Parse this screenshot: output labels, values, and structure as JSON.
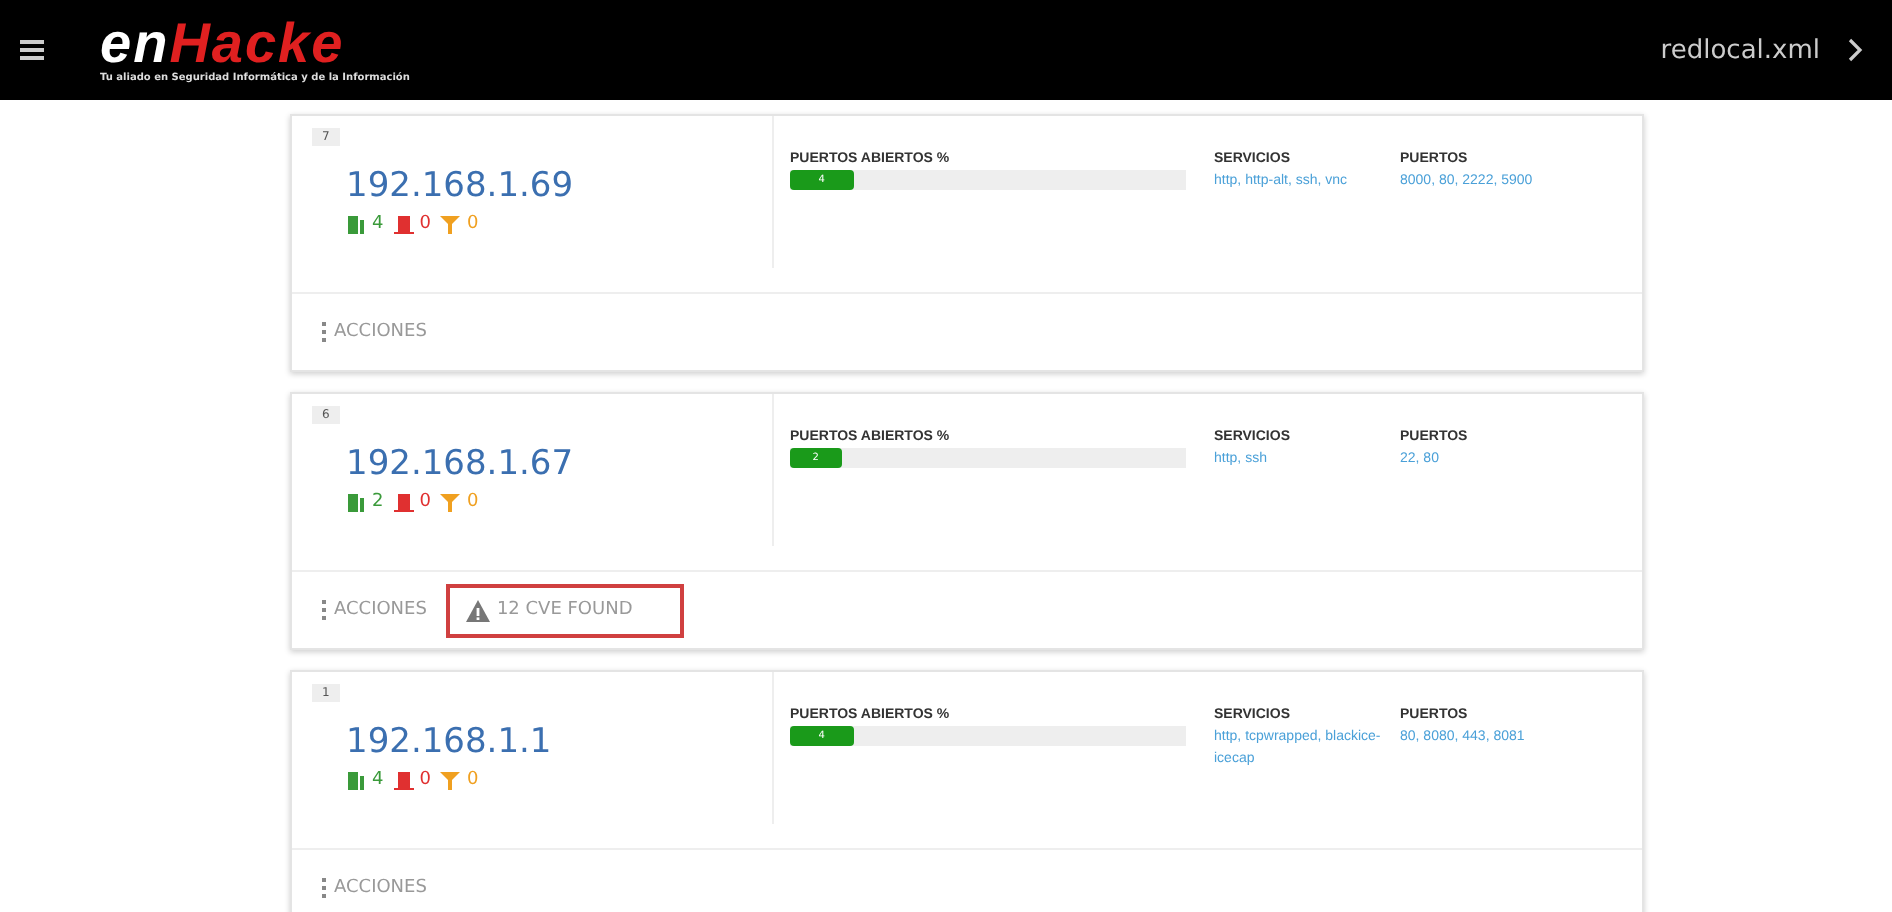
{
  "header": {
    "logo": {
      "prefix": "en",
      "suffix": "Hacke",
      "tagline": "Tu aliado en Seguridad Informática y de la Información"
    },
    "file": "redlocal.xml"
  },
  "hosts": [
    {
      "index": "7",
      "ip": "192.168.1.69",
      "counts": [
        {
          "kind": "open",
          "value": "4"
        },
        {
          "kind": "closed",
          "value": "0"
        },
        {
          "kind": "filtered",
          "value": "0"
        }
      ],
      "bar_title": "PUERTOS ABIERTOS %",
      "bar": {
        "level": 0.16,
        "label": "4"
      },
      "services_title": "SERVICIOS",
      "services": "http, http-alt, ssh, vnc",
      "ports_title": "PUERTOS",
      "ports": "8000, 80, 2222, 5900",
      "actions": "ACCIONES"
    },
    {
      "index": "6",
      "ip": "192.168.1.67",
      "counts": [
        {
          "kind": "open",
          "value": "2"
        },
        {
          "kind": "closed",
          "value": "0"
        },
        {
          "kind": "filtered",
          "value": "0"
        }
      ],
      "bar_title": "PUERTOS ABIERTOS %",
      "bar": {
        "level": 0.13,
        "label": "2"
      },
      "services_title": "SERVICIOS",
      "services": "http, ssh",
      "ports_title": "PUERTOS",
      "ports": "22, 80",
      "actions": "ACCIONES",
      "cve": {
        "text": "12 CVE FOUND",
        "highlighted": true
      }
    },
    {
      "index": "1",
      "ip": "192.168.1.1",
      "counts": [
        {
          "kind": "open",
          "value": "4"
        },
        {
          "kind": "closed",
          "value": "0"
        },
        {
          "kind": "filtered",
          "value": "0"
        }
      ],
      "bar_title": "PUERTOS ABIERTOS %",
      "bar": {
        "level": 0.16,
        "label": "4"
      },
      "services_title": "SERVICIOS",
      "services": "http, tcpwrapped, blackice-icecap",
      "ports_title": "PUERTOS",
      "ports": "80, 8080, 443, 8081",
      "actions": "ACCIONES"
    }
  ]
}
